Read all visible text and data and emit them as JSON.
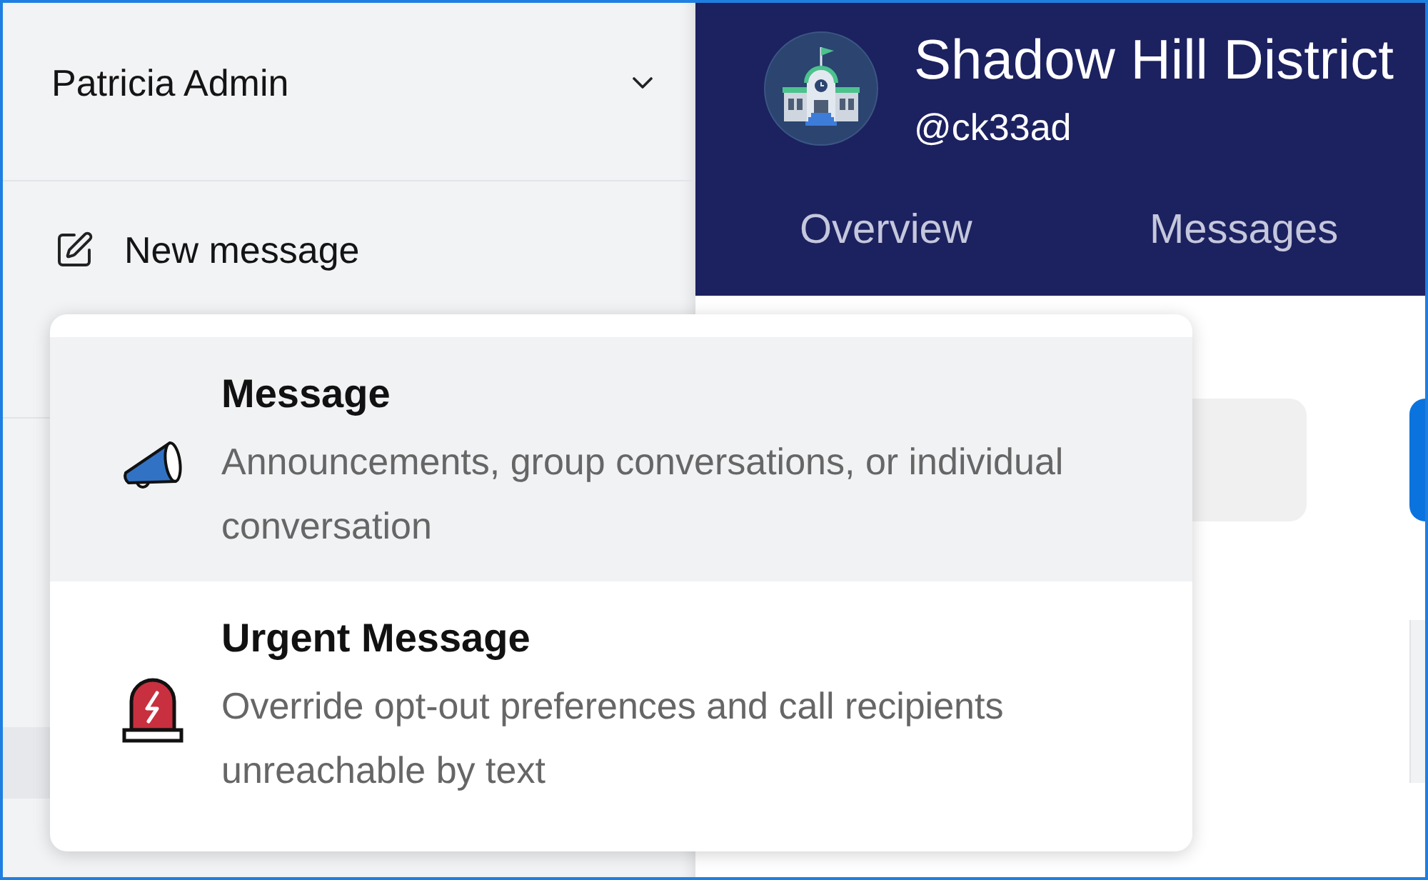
{
  "sidebar": {
    "account": {
      "name": "Patricia Admin"
    },
    "new_message": {
      "label": "New message"
    }
  },
  "header": {
    "title": "Shadow Hill District",
    "handle": "@ck33ad",
    "tabs": [
      {
        "label": "Overview",
        "selected": false
      },
      {
        "label": "Messages",
        "selected": false
      }
    ]
  },
  "new_message_menu": {
    "items": [
      {
        "kind": "message",
        "title": "Message",
        "description": "Announcements, group conversations, or individual conversation",
        "selected": true
      },
      {
        "kind": "urgent",
        "title": "Urgent Message",
        "description": "Override opt-out preferences and call recipients unreachable by text",
        "selected": false
      }
    ]
  }
}
